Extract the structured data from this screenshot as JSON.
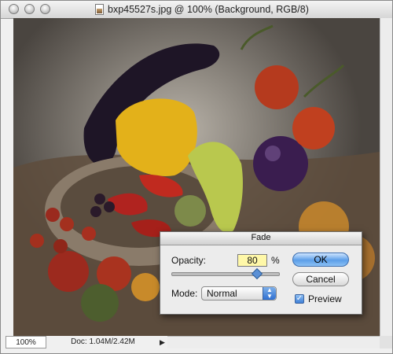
{
  "window": {
    "title": "bxp45527s.jpg @ 100% (Background, RGB/8)"
  },
  "status": {
    "zoom": "100%",
    "doc_info": "Doc: 1.04M/2.42M",
    "menu_arrow": "▶"
  },
  "dialog": {
    "title": "Fade",
    "opacity_label": "Opacity:",
    "opacity_value": "80",
    "opacity_unit": "%",
    "opacity_fraction": 0.8,
    "mode_label": "Mode:",
    "mode_value": "Normal",
    "ok_label": "OK",
    "cancel_label": "Cancel",
    "preview_label": "Preview",
    "preview_checked": true
  },
  "colors": {
    "accent": "#5b9ee8",
    "opacity_field": "#fff8a8"
  },
  "icons": [
    "close-button",
    "minimize-button",
    "zoom-button",
    "document-icon",
    "checkmark-icon",
    "popup-arrows-icon",
    "triangle-right-icon"
  ]
}
